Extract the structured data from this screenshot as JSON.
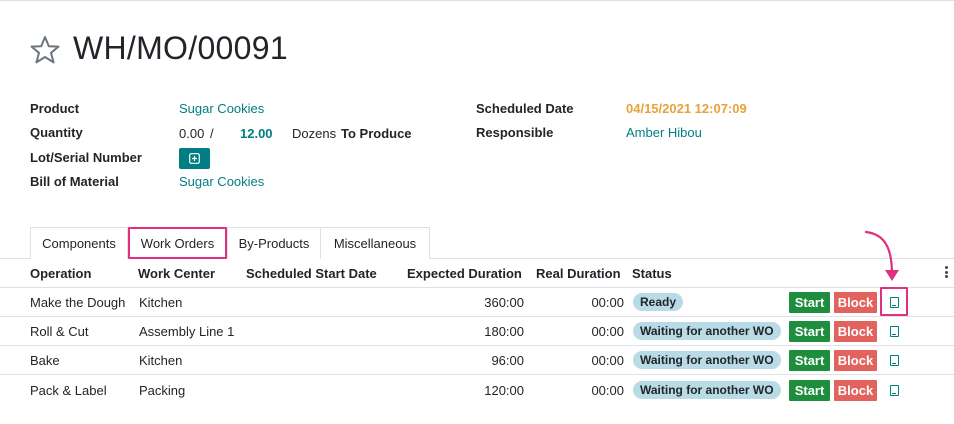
{
  "header": {
    "title": "WH/MO/00091"
  },
  "form": {
    "product_label": "Product",
    "product_value": "Sugar Cookies",
    "quantity_label": "Quantity",
    "quantity_done": "0.00",
    "quantity_sep": "/",
    "quantity_target": "12.00",
    "quantity_uom": "Dozens",
    "quantity_suffix": "To Produce",
    "lot_label": "Lot/Serial Number",
    "bom_label": "Bill of Material",
    "bom_value": "Sugar Cookies",
    "scheduled_label": "Scheduled Date",
    "scheduled_value": "04/15/2021 12:07:09",
    "responsible_label": "Responsible",
    "responsible_value": "Amber Hibou"
  },
  "tabs": [
    {
      "label": "Components"
    },
    {
      "label": "Work Orders"
    },
    {
      "label": "By-Products"
    },
    {
      "label": "Miscellaneous"
    }
  ],
  "table": {
    "headers": [
      "Operation",
      "Work Center",
      "Scheduled Start Date",
      "Expected Duration",
      "Real Duration",
      "Status"
    ],
    "start_label": "Start",
    "block_label": "Block",
    "rows": [
      {
        "operation": "Make the Dough",
        "work_center": "Kitchen",
        "start_date": "",
        "expected": "360:00",
        "real": "00:00",
        "status": "Ready"
      },
      {
        "operation": "Roll & Cut",
        "work_center": "Assembly Line 1",
        "start_date": "",
        "expected": "180:00",
        "real": "00:00",
        "status": "Waiting for another WO"
      },
      {
        "operation": "Bake",
        "work_center": "Kitchen",
        "start_date": "",
        "expected": "96:00",
        "real": "00:00",
        "status": "Waiting for another WO"
      },
      {
        "operation": "Pack & Label",
        "work_center": "Packing",
        "start_date": "",
        "expected": "120:00",
        "real": "00:00",
        "status": "Waiting for another WO"
      }
    ]
  },
  "colors": {
    "accent": "#017e84",
    "highlight": "#e0307f",
    "start": "#1e8e3e",
    "block": "#e2625d",
    "badge": "#b8dbe6",
    "date": "#e9a23b"
  },
  "icons": {
    "favorite": "star-icon",
    "lot_add": "plus-square-icon",
    "tablet": "tablet-icon",
    "options": "kebab-icon"
  }
}
